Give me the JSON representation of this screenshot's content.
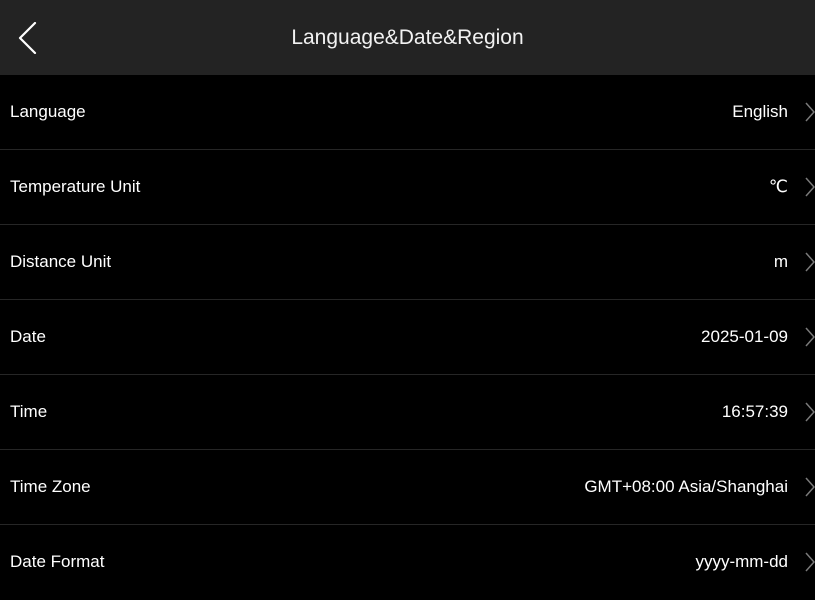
{
  "header": {
    "title": "Language&Date&Region",
    "back_icon": "chevron-left-icon"
  },
  "rows": [
    {
      "label": "Language",
      "value": "English"
    },
    {
      "label": "Temperature Unit",
      "value": "℃"
    },
    {
      "label": "Distance Unit",
      "value": "m"
    },
    {
      "label": "Date",
      "value": "2025-01-09"
    },
    {
      "label": "Time",
      "value": "16:57:39"
    },
    {
      "label": "Time Zone",
      "value": "GMT+08:00 Asia/Shanghai"
    },
    {
      "label": "Date Format",
      "value": "yyyy-mm-dd"
    }
  ],
  "row_icon": "chevron-right-icon",
  "colors": {
    "background": "#000000",
    "header": "#232323",
    "divider": "#262626",
    "text": "#ffffff",
    "chevron": "#7a7a7a"
  }
}
